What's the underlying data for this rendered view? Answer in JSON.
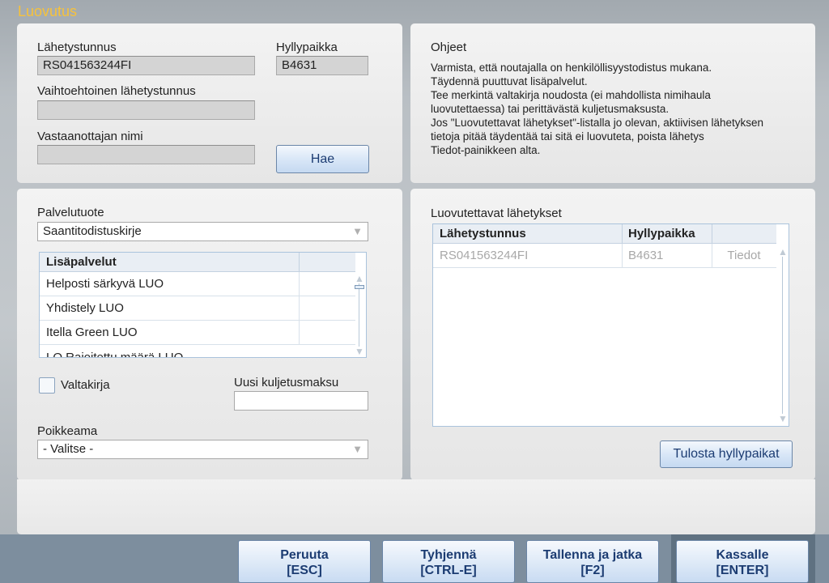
{
  "app": {
    "title": "Luovutus"
  },
  "search": {
    "tracking_label": "Lähetystunnus",
    "tracking_value": "RS041563244FI",
    "shelf_label": "Hyllypaikka",
    "shelf_value": "B4631",
    "alt_tracking_label": "Vaihtoehtoinen lähetystunnus",
    "alt_tracking_value": "",
    "recipient_label": "Vastaanottajan nimi",
    "recipient_value": "",
    "fetch_button": "Hae"
  },
  "instructions": {
    "title": "Ohjeet",
    "lines": [
      "Varmista, että noutajalla on henkilöllisyystodistus mukana.",
      "Täydennä puuttuvat lisäpalvelut.",
      "Tee merkintä valtakirja noudosta (ei mahdollista nimihaula",
      "luovutettaessa) tai perittävästä kuljetusmaksusta.",
      "Jos \"Luovutettavat lähetykset\"-listalla jo olevan, aktiivisen lähetyksen",
      "tietoja pitää täydentää tai sitä ei luovuteta, poista lähetys",
      "Tiedot-painikkeen alta."
    ]
  },
  "service": {
    "product_label": "Palvelutuote",
    "product_value": "Saantitodistuskirje",
    "addons_header": "Lisäpalvelut",
    "addons": [
      "Helposti särkyvä LUO",
      "Yhdistely LUO",
      "Itella Green LUO",
      "LO Rajoitettu määrä LUO"
    ],
    "proxy_label": "Valtakirja",
    "new_fee_label": "Uusi kuljetusmaksu",
    "new_fee_value": "",
    "deviation_label": "Poikkeama",
    "deviation_value": "- Valitse -"
  },
  "deliverables": {
    "title": "Luovutettavat lähetykset",
    "columns": [
      "Lähetystunnus",
      "Hyllypaikka"
    ],
    "rows": [
      {
        "tracking": "RS041563244FI",
        "shelf": "B4631",
        "details": "Tiedot"
      }
    ],
    "print_button": "Tulosta hyllypaikat"
  },
  "actions": [
    {
      "label": "Peruuta",
      "key": "[ESC]"
    },
    {
      "label": "Tyhjennä",
      "key": "[CTRL-E]"
    },
    {
      "label": "Tallenna ja jatka",
      "key": "[F2]"
    },
    {
      "label": "Kassalle",
      "key": "[ENTER]"
    }
  ]
}
